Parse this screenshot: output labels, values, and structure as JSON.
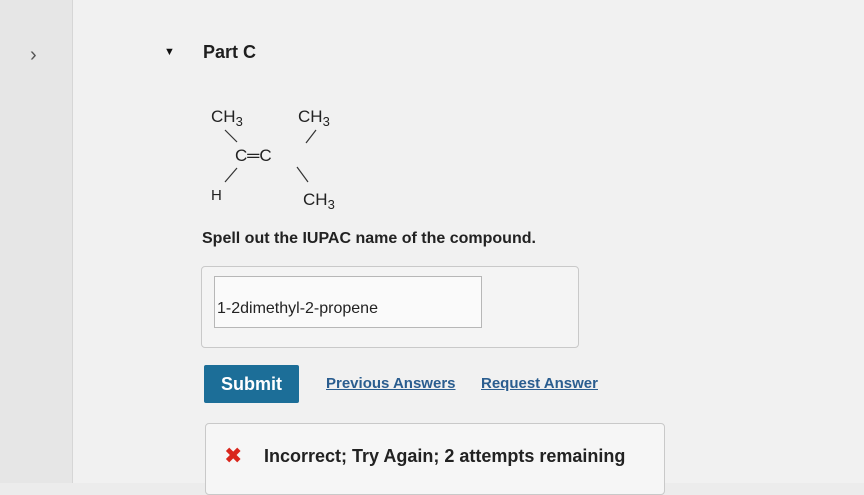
{
  "nav": {
    "expand_glyph": "›"
  },
  "part": {
    "toggle_glyph": "▼",
    "title": "Part C"
  },
  "structure": {
    "top_left": "CH3",
    "top_right": "CH3",
    "center": "C═C",
    "bottom_left": "H",
    "bottom_right": "CH3"
  },
  "question": {
    "prompt": "Spell out the IUPAC name of the compound."
  },
  "answer": {
    "value": "1-2dimethyl-2-propene"
  },
  "actions": {
    "submit_label": "Submit",
    "previous_answers_label": "Previous Answers",
    "request_answer_label": "Request Answer"
  },
  "feedback": {
    "icon": "✖",
    "message": "Incorrect; Try Again; 2 attempts remaining"
  },
  "colors": {
    "submit": "#1c6e98",
    "link": "#2a5d8f",
    "error_icon": "#d9261c"
  }
}
